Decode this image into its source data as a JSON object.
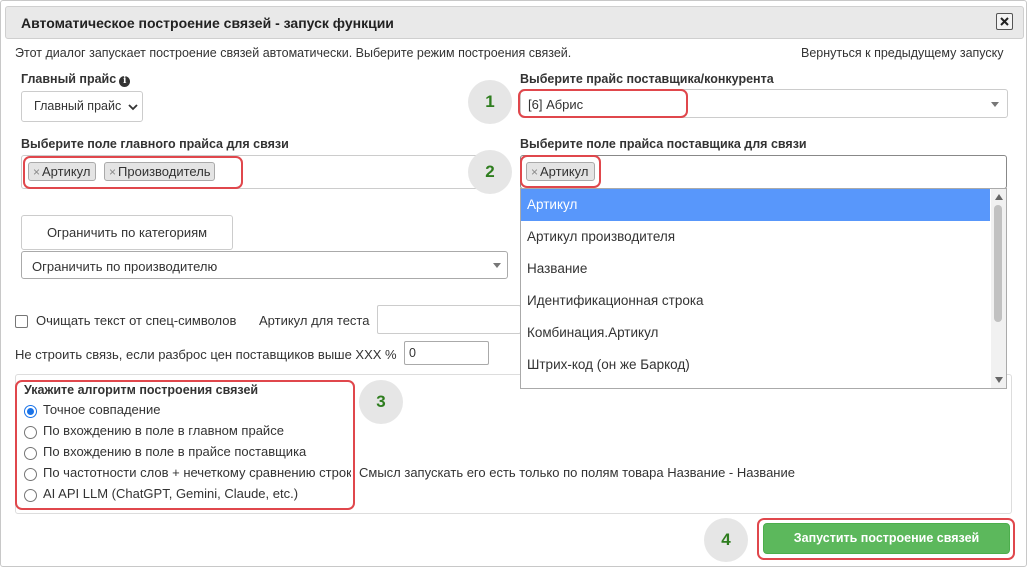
{
  "dialog": {
    "title": "Автоматическое построение связей - запуск функции",
    "description": "Этот диалог запускает построение связей автоматически. Выберите режим построения связей.",
    "back_link": "Вернуться к предыдущему запуску"
  },
  "main_price": {
    "label": "Главный прайс",
    "info_icon": "info-icon",
    "selected": "Главный прайс"
  },
  "supplier_price": {
    "label": "Выберите прайс поставщика/конкурента",
    "selected": "[6] Абрис"
  },
  "main_field": {
    "label": "Выберите поле главного прайса для связи",
    "tags": [
      "Артикул",
      "Производитель"
    ]
  },
  "supplier_field": {
    "label": "Выберите поле прайса поставщика для связи",
    "tags": [
      "Артикул"
    ],
    "options": [
      "Артикул",
      "Артикул производителя",
      "Название",
      "Идентификационная строка",
      "Комбинация.Артикул",
      "Штрих-код (он же Баркод)"
    ],
    "highlighted": "Артикул"
  },
  "steps": [
    "1",
    "2",
    "3",
    "4"
  ],
  "restrict_categories_button": "Ограничить по категориям",
  "restrict_manufacturer": {
    "selected": "Ограничить по производителю"
  },
  "clean_text": {
    "label": "Очищать текст от спец-символов",
    "checked": false
  },
  "test_article": {
    "label": "Артикул для теста",
    "value": ""
  },
  "spread": {
    "label": "Не строить связь, если разброс цен поставщиков выше XXX %",
    "value": "0"
  },
  "algorithm": {
    "label": "Укажите алгоритм построения связей",
    "options": [
      "Точное совпадение",
      "По вхождению в поле в главном прайсе",
      "По вхождению в поле в прайсе поставщика",
      "По частотности слов + нечеткому сравнению строк",
      "AI API LLM (ChatGPT, Gemini, Claude, etc.)"
    ],
    "selected_index": 0,
    "note": "Смысл запускать его есть только по полям товара Название - Название"
  },
  "run_button": "Запустить построение связей",
  "colors": {
    "accent_green": "#5cb85c",
    "highlight_red": "#e0474c",
    "step_number": "#2e7d1e",
    "dropdown_selected": "#5897fb"
  }
}
